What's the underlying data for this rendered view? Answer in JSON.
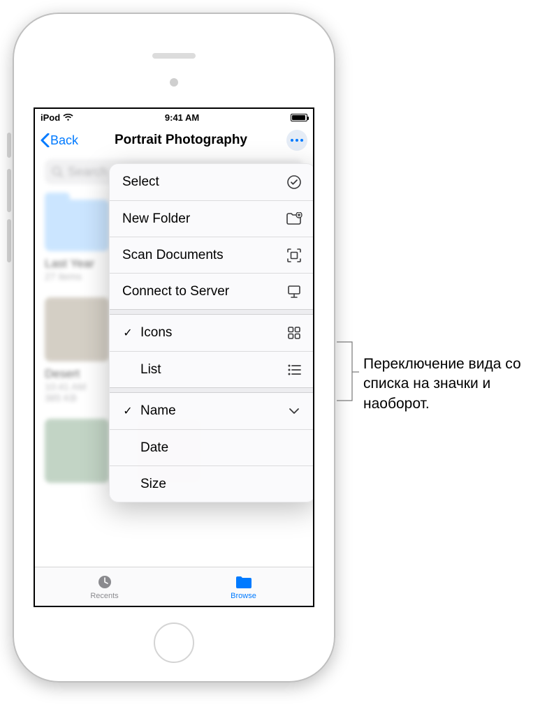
{
  "status": {
    "carrier": "iPod",
    "time": "9:41 AM"
  },
  "nav": {
    "back": "Back",
    "title": "Portrait Photography"
  },
  "search": {
    "placeholder": "Search"
  },
  "folder": {
    "name": "Last Year",
    "subtitle": "27 items"
  },
  "photo_item": {
    "name": "Desert",
    "time": "10:41 AM",
    "size": "385 KB"
  },
  "menu": {
    "select": "Select",
    "new_folder": "New Folder",
    "scan": "Scan Documents",
    "connect": "Connect to Server",
    "icons": "Icons",
    "list": "List",
    "name": "Name",
    "date": "Date",
    "size": "Size"
  },
  "tabs": {
    "recents": "Recents",
    "browse": "Browse"
  },
  "callout": "Переключение вида со списка на значки и наоборот."
}
